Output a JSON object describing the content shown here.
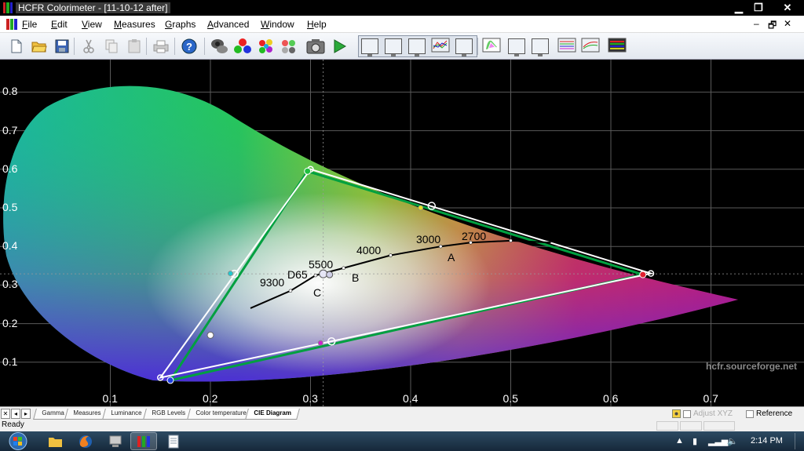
{
  "window": {
    "title": "HCFR Colorimeter - [11-10-12 after]"
  },
  "menu": [
    {
      "label": "File",
      "key": "F",
      "rest": "ile"
    },
    {
      "label": "Edit",
      "key": "E",
      "rest": "dit"
    },
    {
      "label": "View",
      "key": "V",
      "rest": "iew"
    },
    {
      "label": "Measures",
      "key": "M",
      "rest": "easures"
    },
    {
      "label": "Graphs",
      "key": "G",
      "rest": "raphs"
    },
    {
      "label": "Advanced",
      "key": "A",
      "rest": "dvanced"
    },
    {
      "label": "Window",
      "key": "W",
      "rest": "indow"
    },
    {
      "label": "Help",
      "key": "H",
      "rest": "elp"
    }
  ],
  "toolbar": {
    "buttons": [
      "new-document",
      "open-folder",
      "save",
      "cut",
      "copy",
      "paste",
      "print",
      "help",
      "sensor-probe",
      "generator-rgb",
      "measure-colors",
      "measure-grey",
      "camera",
      "play",
      "graph-gamma",
      "graph-luminance",
      "graph-rgb",
      "graph-levels",
      "graph-temperature",
      "graph-cie",
      "graph-saturation",
      "graph-near-black",
      "graph-near-white",
      "graph-multi",
      "graph-histogram"
    ]
  },
  "chart_data": {
    "type": "scatter",
    "title": "",
    "x_ticks": [
      "0.1",
      "0.2",
      "0.3",
      "0.4",
      "0.5",
      "0.6",
      "0.7"
    ],
    "y_ticks": [
      "0.8",
      "0.7",
      "0.6",
      "0.5",
      "0.4",
      "0.3",
      "0.2",
      "0.1"
    ],
    "xlim": [
      0.0,
      0.8
    ],
    "ylim": [
      0.0,
      0.85
    ],
    "reference_gamut": [
      [
        0.64,
        0.33
      ],
      [
        0.3,
        0.6
      ],
      [
        0.15,
        0.06
      ]
    ],
    "measured_gamut": [
      [
        0.632,
        0.327
      ],
      [
        0.297,
        0.595
      ],
      [
        0.16,
        0.053
      ]
    ],
    "reference_secondaries": [
      [
        0.421,
        0.505
      ],
      [
        0.224,
        0.329
      ],
      [
        0.321,
        0.154
      ]
    ],
    "measured_secondaries": [
      [
        0.41,
        0.5
      ],
      [
        0.22,
        0.33
      ],
      [
        0.31,
        0.15
      ]
    ],
    "white_point": [
      0.3127,
      0.329
    ],
    "extra_point": [
      0.2,
      0.17
    ],
    "planckian_curve": [
      [
        0.24,
        0.24
      ],
      [
        0.28,
        0.285
      ],
      [
        0.305,
        0.325
      ],
      [
        0.333,
        0.344
      ],
      [
        0.38,
        0.377
      ],
      [
        0.43,
        0.4
      ],
      [
        0.46,
        0.41
      ],
      [
        0.5,
        0.415
      ],
      [
        0.54,
        0.41
      ]
    ],
    "curve_labels": [
      "9300",
      "D65",
      "5500",
      "4000",
      "3000",
      "2700",
      "A",
      "B",
      "C"
    ],
    "watermark": "hcfr.sourceforge.net"
  },
  "tabs": [
    "Gamma",
    "Measures",
    "Luminance",
    "RGB Levels",
    "Color temperature",
    "CIE Diagram"
  ],
  "active_tab": "CIE Diagram",
  "options": {
    "adjust_xyz": "Adjust XYZ",
    "reference": "Reference"
  },
  "status": {
    "text": "Ready"
  },
  "taskbar": {
    "time": "2:14 PM"
  },
  "colors": {
    "reference_line": "#ffffff",
    "measured_line": "#00aa44",
    "curve": "#000000"
  }
}
